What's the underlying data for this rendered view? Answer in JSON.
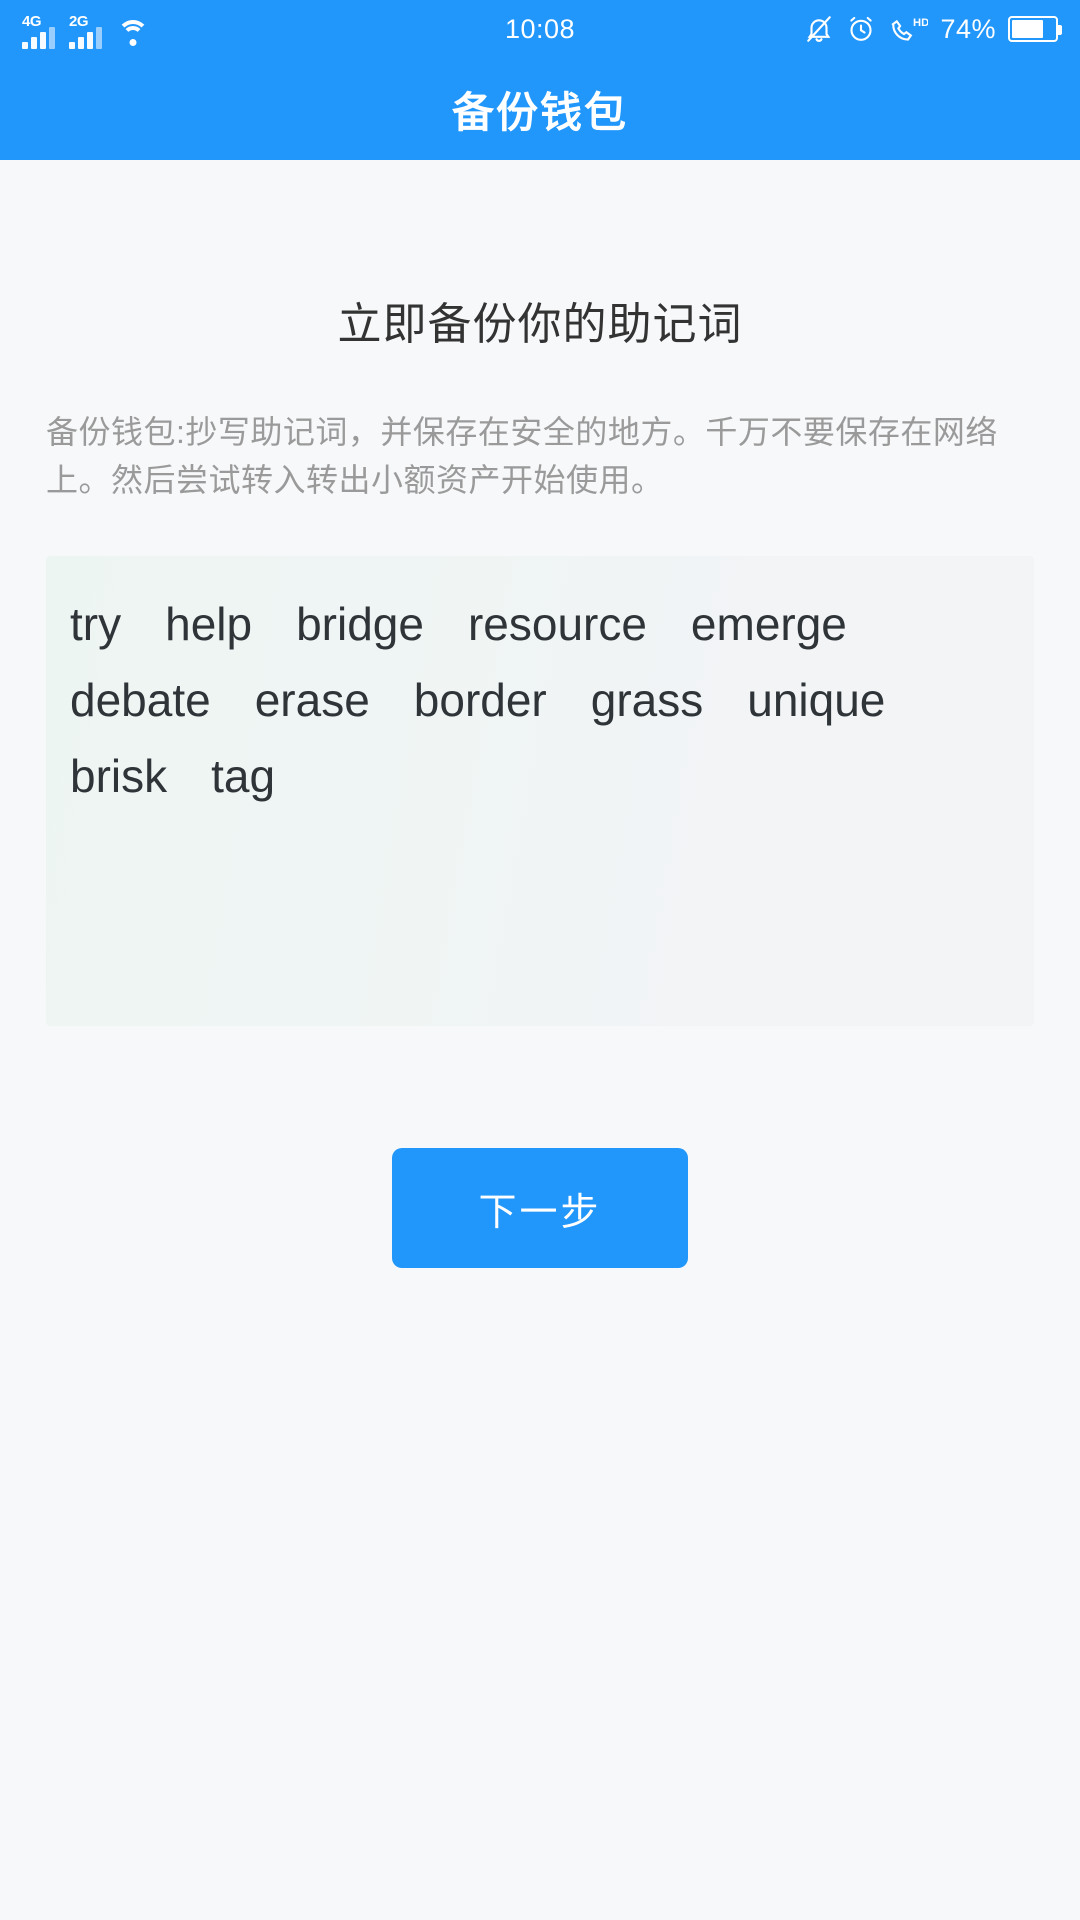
{
  "status_bar": {
    "time": "10:08",
    "battery_percent": "74%",
    "battery_level": 74,
    "networks": [
      {
        "label": "4G",
        "icon": "signal-bars-icon"
      },
      {
        "label": "2G",
        "icon": "signal-bars-icon"
      }
    ],
    "icons": [
      "wifi-icon",
      "bell-muted-icon",
      "alarm-clock-icon",
      "volte-hd-call-icon",
      "battery-icon"
    ]
  },
  "app_bar": {
    "title": "备份钱包"
  },
  "main": {
    "heading": "立即备份你的助记词",
    "description": "备份钱包:抄写助记词，并保存在安全的地方。千万不要保存在网络上。然后尝试转入转出小额资产开始使用。",
    "mnemonic_words": [
      "try",
      "help",
      "bridge",
      "resource",
      "emerge",
      "debate",
      "erase",
      "border",
      "grass",
      "unique",
      "brisk",
      "tag"
    ],
    "next_button_label": "下一步"
  },
  "colors": {
    "accent": "#2196fb",
    "page_bg": "#f7f8fa",
    "mnemonic_bg": "#eef5f3",
    "heading_text": "#333333",
    "body_text": "#9a9a9a",
    "word_text": "#2f3439"
  }
}
